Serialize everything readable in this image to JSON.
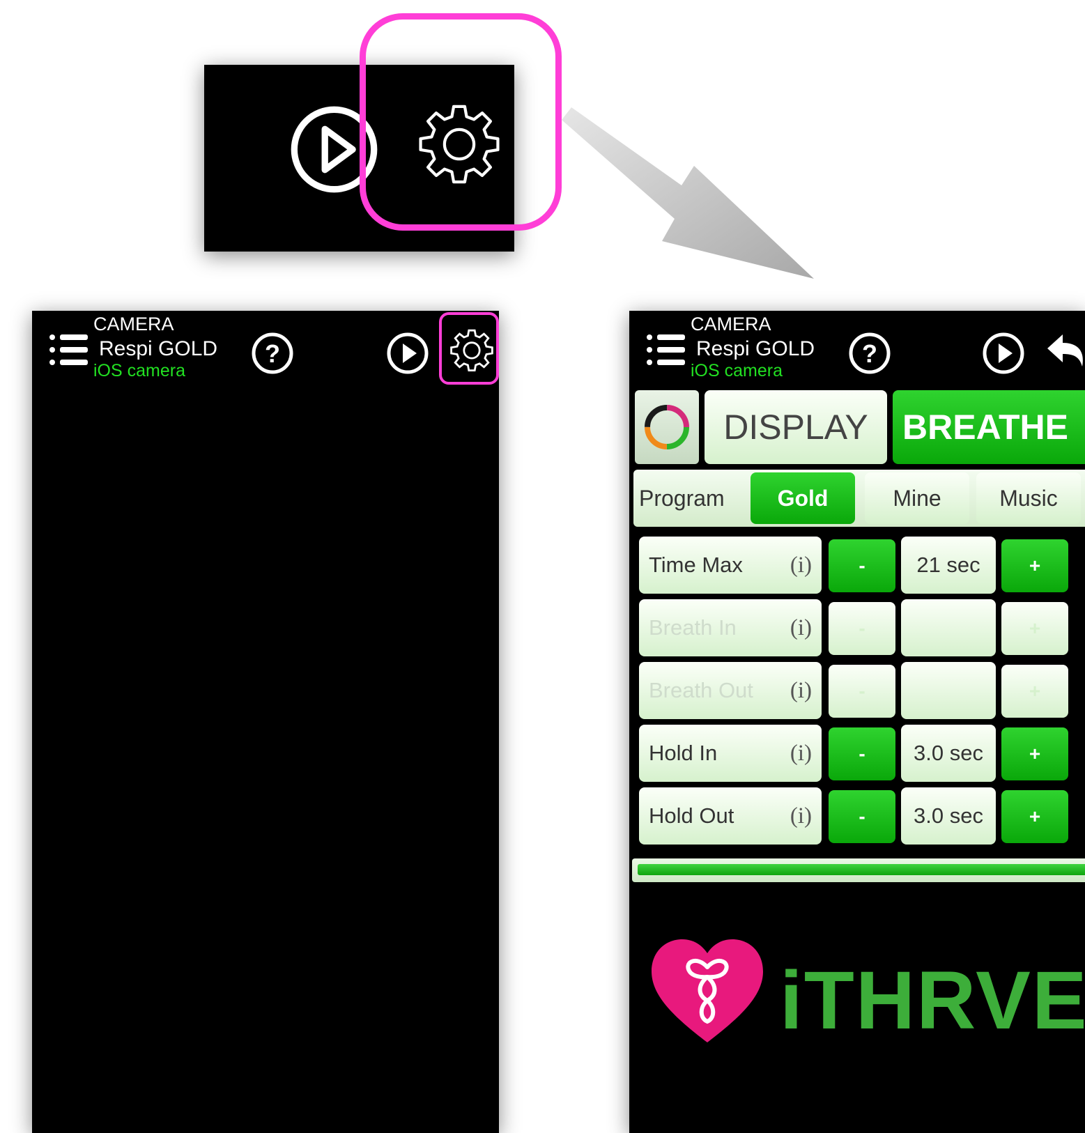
{
  "header": {
    "line1": "CAMERA",
    "line2": "Respi GOLD",
    "line3": "iOS camera"
  },
  "icons": {
    "menu": "hamburger-menu-icon",
    "help": "question-circle-icon",
    "play": "play-circle-icon",
    "settings": "gear-icon",
    "back": "back-arrow-icon"
  },
  "top_buttons": {
    "display": "DISPLAY",
    "breathe": "BREATHE"
  },
  "tabs": [
    {
      "label": "Program",
      "active": false
    },
    {
      "label": "Gold",
      "active": true
    },
    {
      "label": "Mine",
      "active": false
    },
    {
      "label": "Music",
      "active": false
    }
  ],
  "settings_rows": [
    {
      "label": "Time Max",
      "info": "(i)",
      "minus": "-",
      "value": "21 sec",
      "plus": "+",
      "enabled": true
    },
    {
      "label": "Breath In",
      "info": "(i)",
      "minus": "-",
      "value": "",
      "plus": "+",
      "enabled": false
    },
    {
      "label": "Breath Out",
      "info": "(i)",
      "minus": "-",
      "value": "",
      "plus": "+",
      "enabled": false
    },
    {
      "label": "Hold In",
      "info": "(i)",
      "minus": "-",
      "value": "3.0 sec",
      "plus": "+",
      "enabled": true
    },
    {
      "label": "Hold Out",
      "info": "(i)",
      "minus": "-",
      "value": "3.0 sec",
      "plus": "+",
      "enabled": true
    }
  ],
  "logo": {
    "text": "iTHRVE"
  },
  "colors": {
    "highlight": "#ff3ed7",
    "accent_green": "#14b814",
    "header_green": "#22e022",
    "logo_pink": "#e8197d",
    "logo_green": "#3dae3a"
  }
}
